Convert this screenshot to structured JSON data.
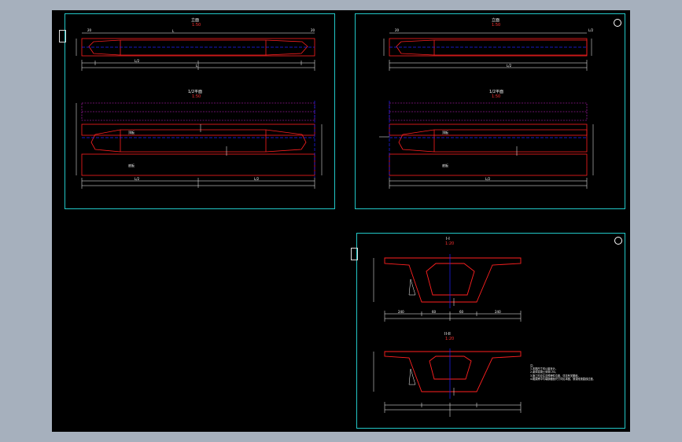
{
  "colors": {
    "background": "#a6b0bd",
    "canvas": "#000000",
    "frame": "#22c7c7",
    "outline": "#ff2020",
    "axis": "#2020ff",
    "hatch": "#cc22cc",
    "dim": "#ffffff"
  },
  "sheets": [
    {
      "name": "sheet-top-left",
      "elev_title": "立面",
      "elev_scale": "1:50",
      "dims_top": [
        "20",
        "1?",
        "L",
        "1?",
        "20"
      ],
      "dims_bottom": [
        "L/2",
        "L"
      ],
      "plan_title": "1/2平面",
      "plan_scale": "1:50",
      "dims_plan": [
        "L/2",
        "L/2"
      ],
      "plan_label_top": "顶板",
      "plan_label_bottom": "底板"
    },
    {
      "name": "sheet-top-right",
      "elev_title": "立面",
      "elev_scale": "1:50",
      "dims_top": [
        "20",
        "L/2"
      ],
      "dims_bottom": [
        "L/2"
      ],
      "plan_title": "1/2平面",
      "plan_scale": "1:50",
      "dims_plan": [
        "L/2"
      ],
      "plan_label_top": "顶板",
      "plan_label_bottom": "底板"
    },
    {
      "name": "sheet-bottom-right",
      "section_a_title": "I-I",
      "section_a_scale": "1:20",
      "section_b_title": "II-II",
      "section_b_scale": "1:20",
      "dims": [
        "240",
        "60",
        "60",
        "240"
      ],
      "notes_title": "注：",
      "notes": [
        "1.本图尺寸均以厘米计。",
        "2.梁体混凝土采用C50。",
        "3.施工时应注意预埋件位置，详见有关图纸。",
        "4.箱梁跨中与端部截面尺寸详见本图，渐变段按直线过渡。"
      ]
    }
  ]
}
